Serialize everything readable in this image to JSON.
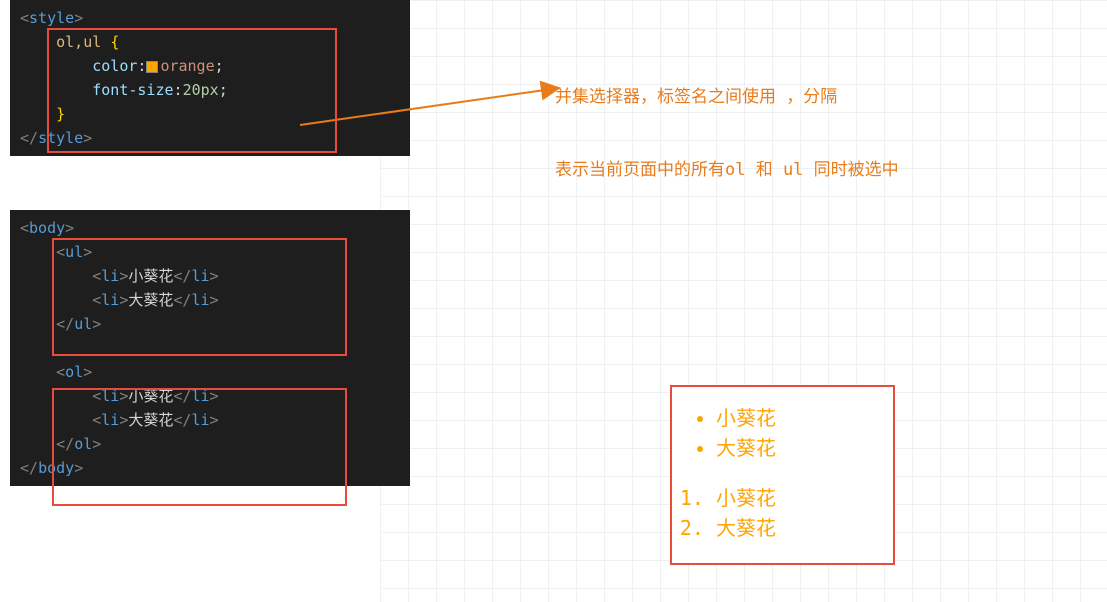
{
  "style_code": {
    "open_tag": "style",
    "selector": "ol,ul",
    "prop1": "color",
    "val1": "orange",
    "prop2": "font-size",
    "val2": "20px",
    "close_tag": "style"
  },
  "body_code": {
    "open_tag": "body",
    "ul": {
      "tag": "ul",
      "li_tag": "li",
      "item1": "小葵花",
      "item2": "大葵花"
    },
    "ol": {
      "tag": "ol",
      "li_tag": "li",
      "item1": "小葵花",
      "item2": "大葵花"
    },
    "close_tag": "body"
  },
  "annot": {
    "line1": "并集选择器，标签名之间使用 ，分隔",
    "line2": "表示当前页面中的所有ol 和 ul 同时被选中"
  },
  "output": {
    "ul": [
      "小葵花",
      "大葵花"
    ],
    "ol": [
      "小葵花",
      "大葵花"
    ]
  },
  "colors": {
    "orange_swatch": "#ffa500",
    "orange_text": "#ffa500"
  }
}
